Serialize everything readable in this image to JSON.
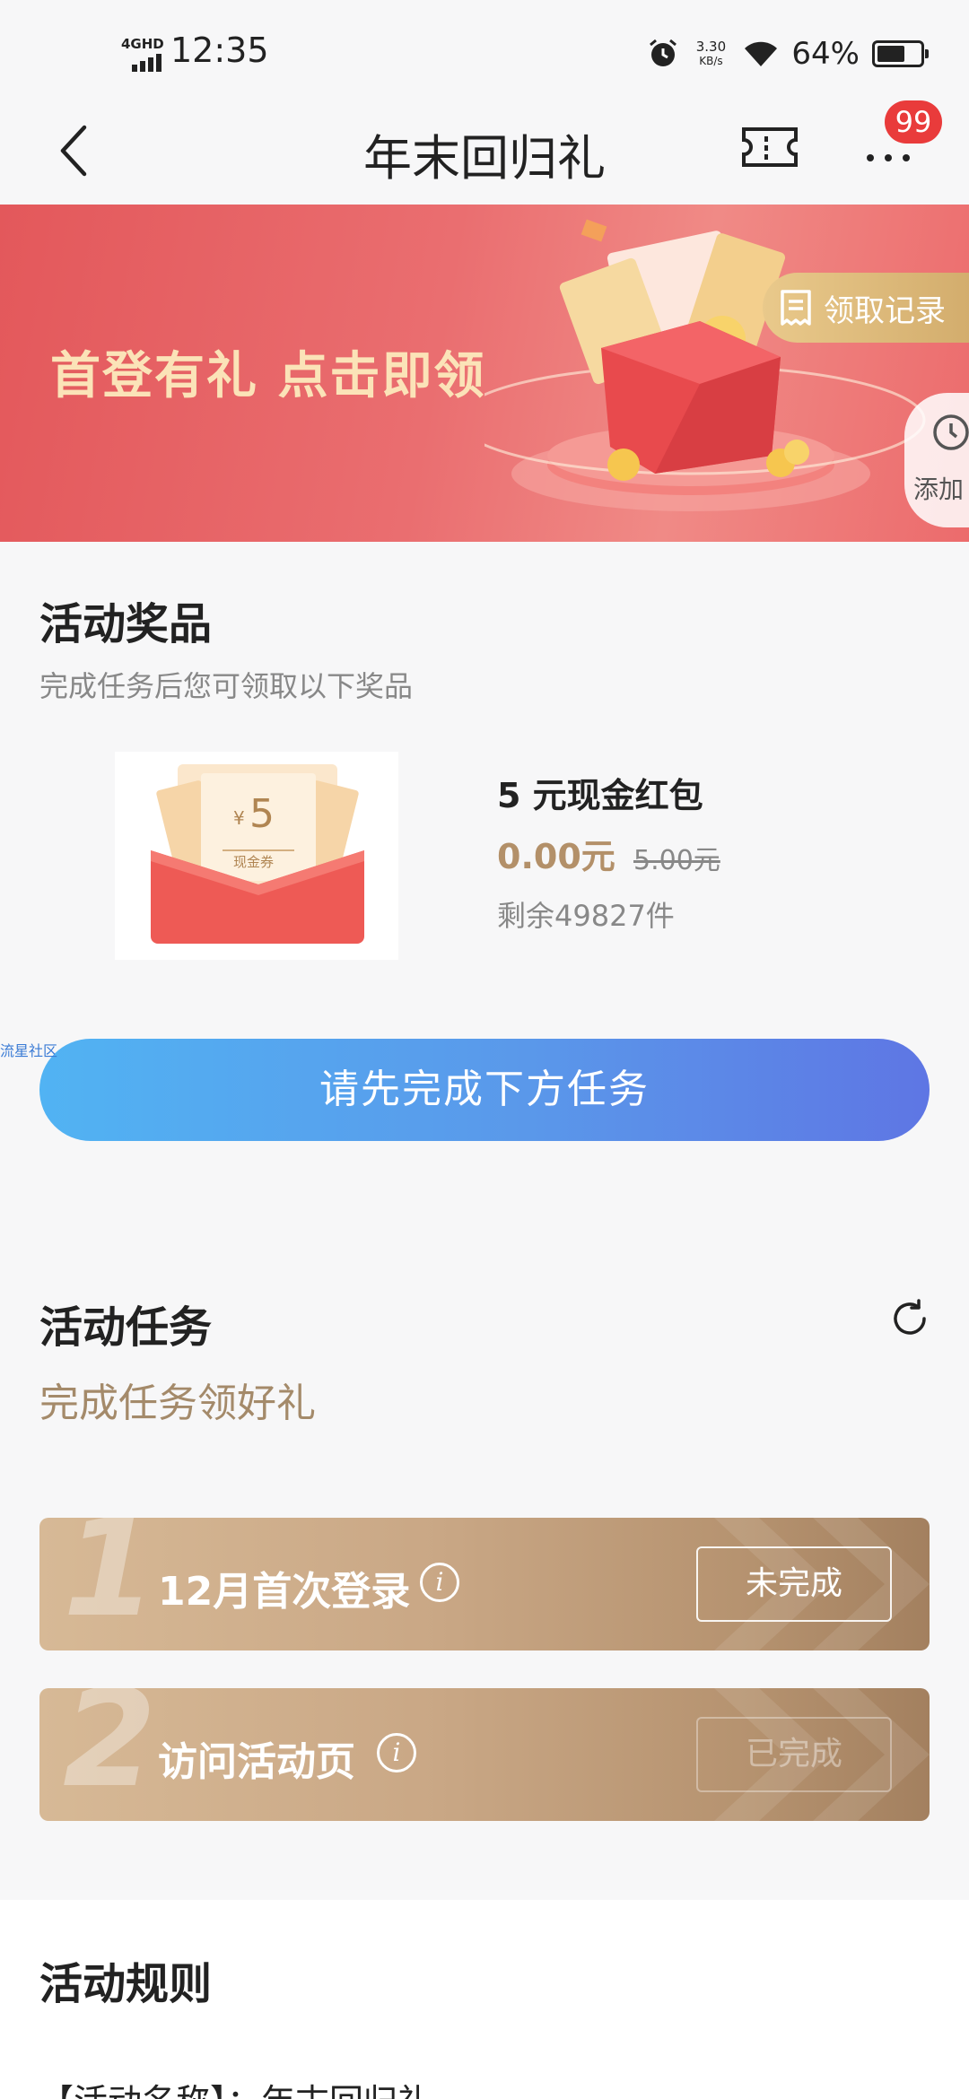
{
  "status_bar": {
    "network": "4GHD",
    "time": "12:35",
    "speed_value": "3.30",
    "speed_unit": "KB/s",
    "battery": "64%",
    "icons": [
      "signal-icon",
      "alarm-icon",
      "wifi-icon",
      "battery-icon"
    ]
  },
  "nav": {
    "title": "年末回归礼",
    "badge": "99",
    "icons": [
      "back-icon",
      "ticket-icon",
      "more-icon"
    ]
  },
  "banner": {
    "text": "首登有礼 点击即领",
    "records_label": "领取记录",
    "add_label": "添加"
  },
  "prizes": {
    "title": "活动奖品",
    "subtitle": "完成任务后您可领取以下奖品",
    "item": {
      "image_amount": "5",
      "image_currency": "¥",
      "image_caption": "现金券",
      "name": "5 元现金红包",
      "price": "0.00元",
      "original_price": "5.00元",
      "stock": "剩余49827件"
    },
    "watermark": "流星社区",
    "cta_label": "请先完成下方任务"
  },
  "tasks": {
    "title": "活动任务",
    "subtitle": "完成任务领好礼",
    "items": [
      {
        "num": "1",
        "name": "12月首次登录",
        "state": "未完成"
      },
      {
        "num": "2",
        "name": "访问活动页",
        "state": "已完成"
      }
    ]
  },
  "rules": {
    "title": "活动规则",
    "first_line": "【活动名称】：年末回归礼"
  },
  "colors": {
    "accent_gold": "#b39069",
    "banner_red": "#e3585b",
    "cta_blue_start": "#51b3f3",
    "cta_blue_end": "#5e76e4",
    "badge_red": "#e93b3b"
  }
}
